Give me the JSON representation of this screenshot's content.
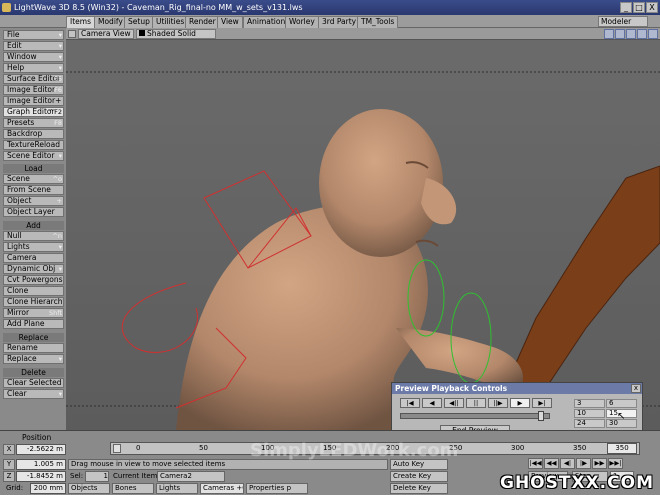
{
  "window": {
    "title": "LightWave 3D 8.5 (Win32) - Caveman_Rig_final-no MM_w_sets_v131.lws",
    "min": "_",
    "max": "□",
    "close": "X"
  },
  "tabs": [
    "Items",
    "Modify",
    "Setup",
    "Utilities",
    "Render",
    "View",
    "Animation",
    "Worley",
    "3rd Party",
    "TM_Tools"
  ],
  "modeler_label": "Modeler",
  "left_toolbar": {
    "top": [
      {
        "label": "File",
        "shortcut": "▾"
      },
      {
        "label": "Edit",
        "shortcut": "▾"
      },
      {
        "label": "Window",
        "shortcut": "▾"
      },
      {
        "label": "Help",
        "shortcut": "▾"
      },
      {
        "label": "Surface Editor",
        "shortcut": "F5"
      },
      {
        "label": "Image Editor",
        "shortcut": "F6"
      },
      {
        "label": "Image Editor+",
        "shortcut": ""
      },
      {
        "label": "Graph Editor",
        "shortcut": "^F2"
      },
      {
        "label": "Presets",
        "shortcut": "F8"
      },
      {
        "label": "Backdrop",
        "shortcut": ""
      },
      {
        "label": "TextureReload",
        "shortcut": ""
      },
      {
        "label": "Scene Editor",
        "shortcut": "▾"
      }
    ],
    "load_header": "Load",
    "load": [
      {
        "label": "Scene",
        "shortcut": "^o"
      },
      {
        "label": "From Scene",
        "shortcut": ""
      },
      {
        "label": "Object",
        "shortcut": "+"
      },
      {
        "label": "Object Layer",
        "shortcut": ""
      }
    ],
    "add_header": "Add",
    "add": [
      {
        "label": "Null",
        "shortcut": "^n"
      },
      {
        "label": "Lights",
        "shortcut": "▾"
      },
      {
        "label": "Camera",
        "shortcut": ""
      },
      {
        "label": "Dynamic Obj",
        "shortcut": "▾"
      },
      {
        "label": "Cvt Powergons",
        "shortcut": ""
      },
      {
        "label": "Clone",
        "shortcut": ""
      },
      {
        "label": "Clone Hierarchy",
        "shortcut": ""
      },
      {
        "label": "Mirror",
        "shortcut": "Shft"
      },
      {
        "label": "Add Plane",
        "shortcut": ""
      }
    ],
    "replace_header": "Replace",
    "replace": [
      {
        "label": "Rename",
        "shortcut": ""
      },
      {
        "label": "Replace",
        "shortcut": "▾"
      }
    ],
    "delete_header": "Delete",
    "delete": [
      {
        "label": "Clear Selected",
        "shortcut": ""
      },
      {
        "label": "Clear",
        "shortcut": "▾"
      }
    ]
  },
  "viewport": {
    "view_mode": "Camera View",
    "shading": "Shaded Solid"
  },
  "preview_panel": {
    "title": "Preview Playback Controls",
    "close": "x",
    "controls": [
      "|◀",
      "◀",
      "◀||",
      "||",
      "||▶",
      "▶",
      "▶|"
    ],
    "slider_position": 0.95,
    "end_button": "End Preview",
    "fps_options": [
      "3",
      "6",
      "10",
      "15",
      "24",
      "30"
    ],
    "fps_selected": "15"
  },
  "timeline": {
    "label": "Position",
    "ticks": [
      "0",
      "50",
      "100",
      "150",
      "200",
      "250",
      "300",
      "350"
    ],
    "current_frame": "350"
  },
  "status": {
    "x": "-2.5622 m",
    "y": "1.005 m",
    "z": "-1.8452 m",
    "grid_label": "Grid:",
    "grid": "200 mm",
    "message": "Drag mouse in view to move selected items",
    "sel_label": "Sel:",
    "sel_count": "1",
    "current_item_label": "Current Item",
    "current_item": "Camera2",
    "objects": "Objects",
    "bones": "Bones",
    "lights": "Lights",
    "cameras": "Cameras",
    "cameras_shortcut": "+C",
    "properties": "Properties",
    "properties_shortcut": "p",
    "auto_key": "Auto Key",
    "create_key": "Create Key",
    "delete_key": "Delete Key",
    "preview": "Preview",
    "step": "Step",
    "step_value": "1",
    "playback_top": [
      "|◀◀",
      "◀◀",
      "◀|",
      "|▶",
      "▶▶",
      "▶▶|"
    ],
    "watermark": "GHOSTXX.COM",
    "watermark_faint": "SimplyLEDWork.com"
  }
}
